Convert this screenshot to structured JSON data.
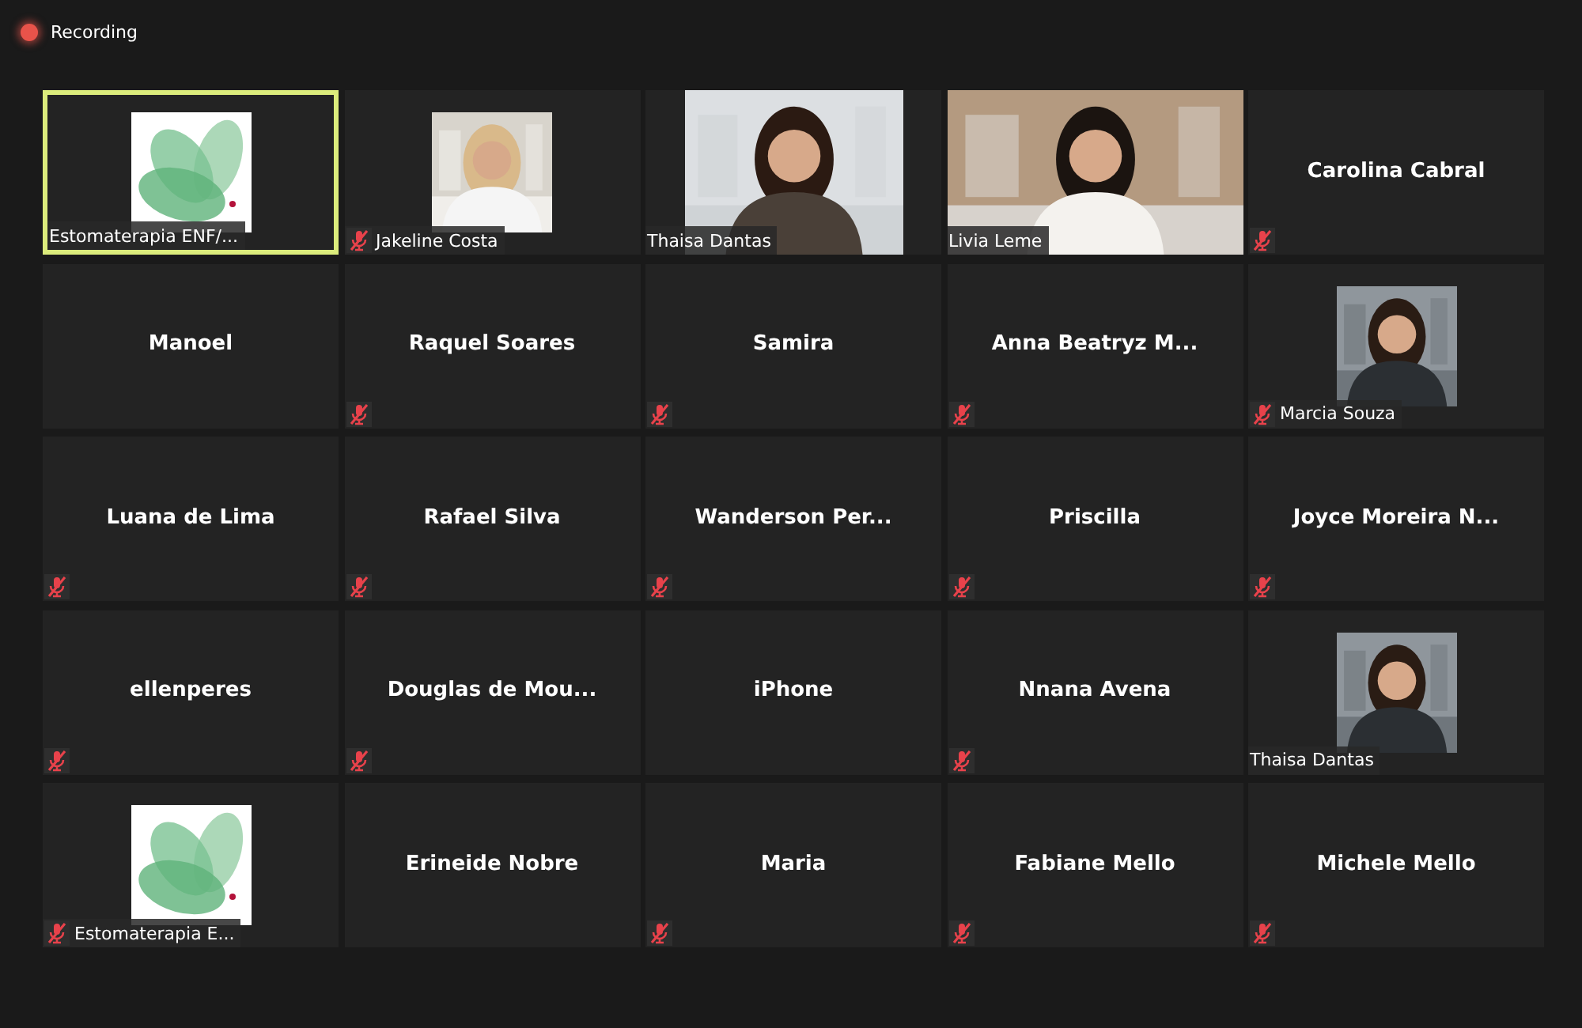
{
  "recording": {
    "label": "Recording"
  },
  "tiles": [
    {
      "kind": "logo",
      "name": "Estomaterapia ENF/...",
      "muted": false,
      "active": true
    },
    {
      "name": "Jakeline Costa",
      "muted": true,
      "active": false
    },
    {
      "kind": "video",
      "name": "Thaisa Dantas",
      "muted": false,
      "active": false
    },
    {
      "kind": "video_full",
      "name": "Livia Leme",
      "muted": false,
      "active": false
    },
    {
      "kind": "name",
      "name": "Carolina Cabral",
      "muted": true,
      "active": false
    },
    {
      "kind": "name",
      "name": "Manoel",
      "muted": false,
      "active": false
    },
    {
      "kind": "name",
      "name": "Raquel Soares",
      "muted": true,
      "active": false
    },
    {
      "kind": "name",
      "name": "Samira",
      "muted": true,
      "active": false
    },
    {
      "kind": "name",
      "name": "Anna Beatryz M...",
      "muted": true,
      "active": false
    },
    {
      "name": "Marcia Souza",
      "muted": true,
      "active": false
    },
    {
      "kind": "name",
      "name": "Luana de Lima",
      "muted": true,
      "active": false
    },
    {
      "kind": "name",
      "name": "Rafael Silva",
      "muted": true,
      "active": false
    },
    {
      "kind": "name",
      "name": "Wanderson Per...",
      "muted": true,
      "active": false
    },
    {
      "kind": "name",
      "name": "Priscilla",
      "muted": true,
      "active": false
    },
    {
      "kind": "name",
      "name": "Joyce Moreira N...",
      "muted": true,
      "active": false
    },
    {
      "kind": "name",
      "name": "ellenperes",
      "muted": true,
      "active": false
    },
    {
      "kind": "name",
      "name": "Douglas de Mou...",
      "muted": true,
      "active": false
    },
    {
      "kind": "name",
      "name": "iPhone",
      "muted": false,
      "active": false
    },
    {
      "kind": "name",
      "name": "Nnana Avena",
      "muted": true,
      "active": false
    },
    {
      "name": "Thaisa Dantas",
      "muted": false,
      "active": false
    },
    {
      "kind": "logo",
      "name": "Estomaterapia E...",
      "muted": true,
      "active": false
    },
    {
      "kind": "name",
      "name": "Erineide Nobre",
      "muted": false,
      "active": false
    },
    {
      "kind": "name",
      "name": "Maria",
      "muted": true,
      "active": false
    },
    {
      "kind": "name",
      "name": "Fabiane Mello",
      "muted": true,
      "active": false
    },
    {
      "kind": "name",
      "name": "Michele Mello",
      "muted": true,
      "active": false
    }
  ]
}
